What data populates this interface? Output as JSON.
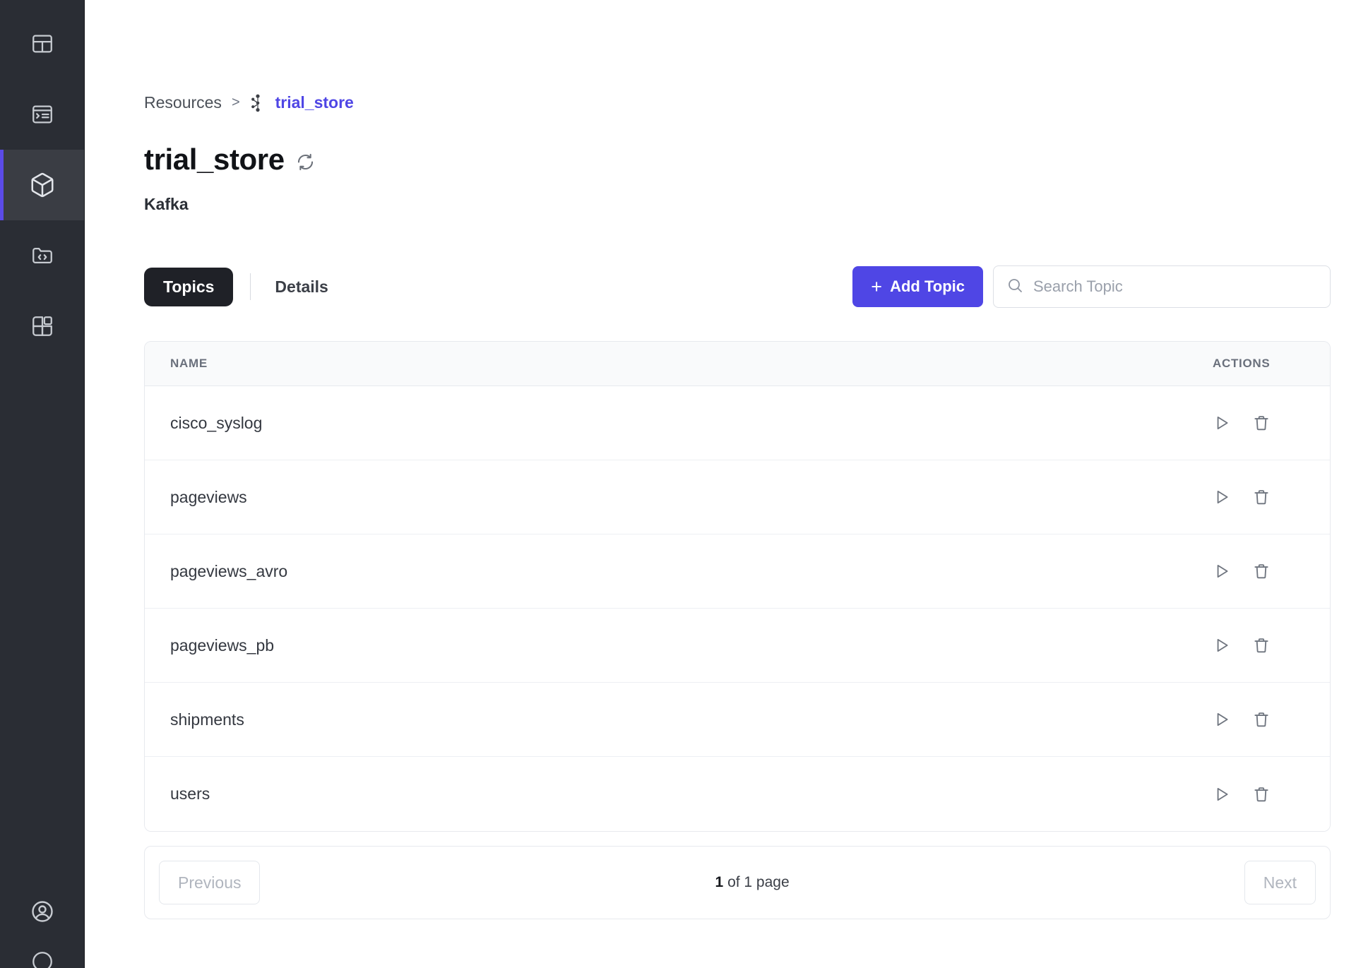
{
  "sidebar": {
    "items": [
      {
        "name": "dashboard",
        "icon": "layout-dashboard-icon",
        "active": false
      },
      {
        "name": "console",
        "icon": "terminal-window-icon",
        "active": false
      },
      {
        "name": "resources",
        "icon": "cube-icon",
        "active": true
      },
      {
        "name": "code-folder",
        "icon": "folder-code-icon",
        "active": false
      },
      {
        "name": "plugins",
        "icon": "blocks-icon",
        "active": false
      }
    ],
    "bottom_items": [
      {
        "name": "account",
        "icon": "user-circle-icon",
        "active": false
      }
    ]
  },
  "breadcrumb": {
    "root": "Resources",
    "separator": ">",
    "leaf_icon": "kafka-icon",
    "leaf": "trial_store"
  },
  "header": {
    "title": "trial_store",
    "refresh_icon": "refresh-icon",
    "subtitle": "Kafka"
  },
  "toolbar": {
    "tabs": [
      {
        "label": "Topics",
        "active": true
      },
      {
        "label": "Details",
        "active": false
      }
    ],
    "add_topic_label": "Add Topic",
    "add_topic_plus": "+",
    "search_icon": "search-icon",
    "search_placeholder": "Search Topic",
    "search_value": ""
  },
  "table": {
    "columns": [
      "NAME",
      "ACTIONS"
    ],
    "rows": [
      {
        "name": "cisco_syslog"
      },
      {
        "name": "pageviews"
      },
      {
        "name": "pageviews_avro"
      },
      {
        "name": "pageviews_pb"
      },
      {
        "name": "shipments"
      },
      {
        "name": "users"
      }
    ],
    "row_actions": [
      {
        "name": "play-icon"
      },
      {
        "name": "trash-icon"
      }
    ]
  },
  "pagination": {
    "previous_label": "Previous",
    "next_label": "Next",
    "current_page": "1",
    "status_suffix": "of 1 page"
  },
  "colors": {
    "accent": "#4F46E5",
    "sidebar_bg": "#2A2D34",
    "sidebar_active_bg": "#3A3D44",
    "tab_active_bg": "#1F2127",
    "table_header_bg": "#F9FAFB"
  }
}
